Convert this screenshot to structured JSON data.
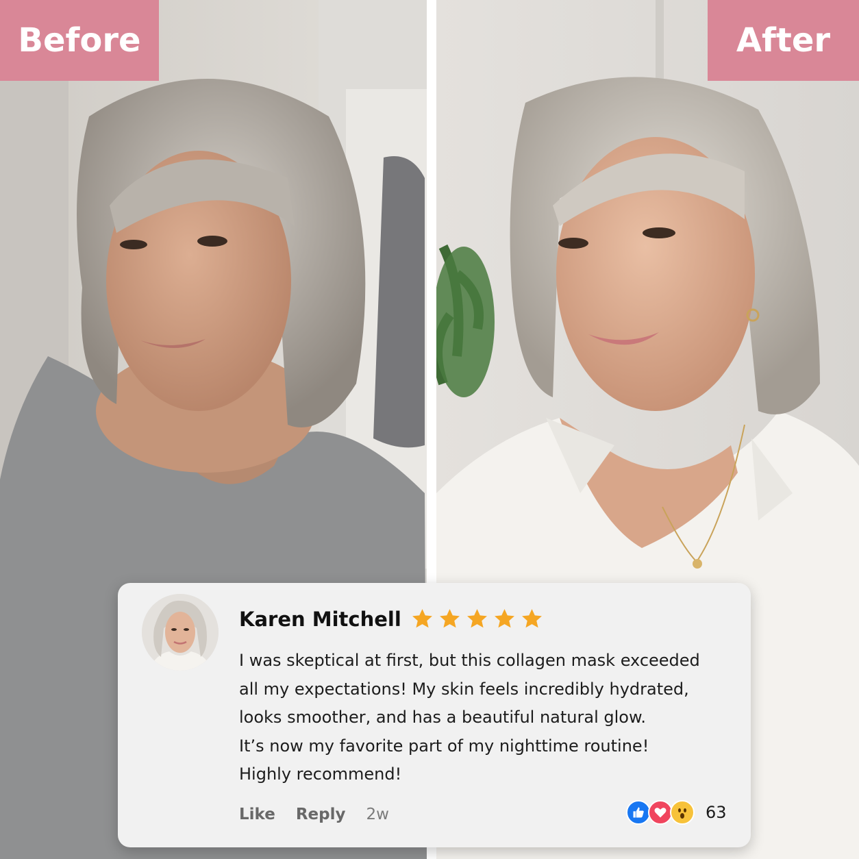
{
  "labels": {
    "before": "Before",
    "after": "After"
  },
  "colors": {
    "label_bg": "#d98797",
    "card_bg": "#f1f1f1",
    "star": "#f5a623"
  },
  "review": {
    "name": "Karen Mitchell",
    "rating": 5,
    "lines": [
      "I was skeptical at first, but this collagen mask exceeded",
      "all my expectations! My skin feels incredibly hydrated,",
      "looks smoother, and has a beautiful natural glow.",
      "It’s now my favorite part of my nighttime routine!",
      "Highly recommend!"
    ],
    "actions": {
      "like": "Like",
      "reply": "Reply",
      "time": "2w"
    },
    "reactions": {
      "icons": [
        "like-icon",
        "love-icon",
        "wow-icon"
      ],
      "count": "63"
    }
  }
}
